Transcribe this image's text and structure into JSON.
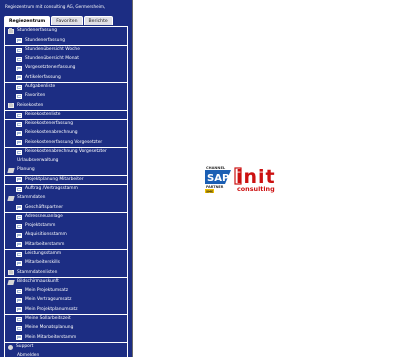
{
  "header": {
    "title": "Regiezentrum mit consulting AG, Germersheim,"
  },
  "tabs": [
    {
      "label": "Regiezentrum",
      "active": true
    },
    {
      "label": "Favoriten",
      "active": false
    },
    {
      "label": "Berichte",
      "active": false
    }
  ],
  "menu": [
    {
      "label": "Stundenerfassung",
      "level": 0,
      "icon": "folder-icon"
    },
    {
      "label": "Stundenerfassung",
      "level": 1,
      "icon": "page-icon"
    },
    {
      "label": "Stundenübersicht Woche",
      "level": 1,
      "icon": "page-icon"
    },
    {
      "label": "Stundenübersicht Monat",
      "level": 1,
      "icon": "page-icon"
    },
    {
      "label": "Vorgesetztenerfassung",
      "level": 1,
      "icon": "page-icon"
    },
    {
      "label": "Artikelerfassung",
      "level": 1,
      "icon": "page-icon"
    },
    {
      "label": "Aufgabenliste",
      "level": 1,
      "icon": "page-icon"
    },
    {
      "label": "Favoriten",
      "level": 1,
      "icon": "page-icon"
    },
    {
      "label": "Reisekosten",
      "level": 0,
      "icon": "folder-icon"
    },
    {
      "label": "Reisekostenliste",
      "level": 1,
      "icon": "page-icon"
    },
    {
      "label": "Reisekostenerfassung",
      "level": 1,
      "icon": "page-icon"
    },
    {
      "label": "Reisekostenabrechnung",
      "level": 1,
      "icon": "page-icon"
    },
    {
      "label": "Reisekostenerfassung Vorgesetzter",
      "level": 1,
      "icon": "page-icon"
    },
    {
      "label": "Reisekostenabrechnung Vorgesetzter",
      "level": 1,
      "icon": "page-icon"
    },
    {
      "label": "Urlaubsverwaltung",
      "level": 0,
      "icon": "none"
    },
    {
      "label": "Planung",
      "level": 0,
      "icon": "open-folder-icon"
    },
    {
      "label": "Projektplanung Mitarbeiter",
      "level": 1,
      "icon": "page-icon"
    },
    {
      "label": "Auftrag /Vertragsstamm",
      "level": 1,
      "icon": "page-icon"
    },
    {
      "label": "Stammdaten",
      "level": 0,
      "icon": "open-folder-icon"
    },
    {
      "label": "Geschäftspartner",
      "level": 1,
      "icon": "page-icon"
    },
    {
      "label": "Adressneuanlage",
      "level": 1,
      "icon": "page-icon"
    },
    {
      "label": "Projektstamm",
      "level": 1,
      "icon": "page-icon"
    },
    {
      "label": "Akquisitionsstamm",
      "level": 1,
      "icon": "page-icon"
    },
    {
      "label": "Mitarbeiterstamm",
      "level": 1,
      "icon": "page-icon"
    },
    {
      "label": "Leistungsstamm",
      "level": 1,
      "icon": "page-icon"
    },
    {
      "label": "Mitarbeiterskills",
      "level": 1,
      "icon": "page-icon"
    },
    {
      "label": "Stammdatenlisten",
      "level": 0,
      "icon": "folder-icon"
    },
    {
      "label": "Bildschirmauskunft",
      "level": 0,
      "icon": "open-folder-icon"
    },
    {
      "label": "Mein Projektumsatz",
      "level": 1,
      "icon": "page-icon"
    },
    {
      "label": "Mein Vertragsumsatz",
      "level": 1,
      "icon": "page-icon"
    },
    {
      "label": "Mein Projektplanumsatz",
      "level": 1,
      "icon": "page-icon"
    },
    {
      "label": "Meine Sollarbeitszeit",
      "level": 1,
      "icon": "page-icon"
    },
    {
      "label": "Meine Monatsplanung",
      "level": 1,
      "icon": "page-icon"
    },
    {
      "label": "Mein Mitarbeiterstamm",
      "level": 1,
      "icon": "page-icon"
    },
    {
      "label": "Support",
      "level": 0,
      "icon": "help-icon"
    },
    {
      "label": "Abmelden",
      "level": 0,
      "icon": "none"
    }
  ],
  "logo": {
    "sap_text": "SAP",
    "badge_top": "CHANNEL",
    "badge_bottom": "PARTNER",
    "badge_tag": "SME",
    "brand": "init",
    "sub": "consulting",
    "colors": {
      "sap_blue": "#1a5fb4",
      "sap_gold": "#f0c000",
      "brand_red": "#cc1111"
    }
  }
}
